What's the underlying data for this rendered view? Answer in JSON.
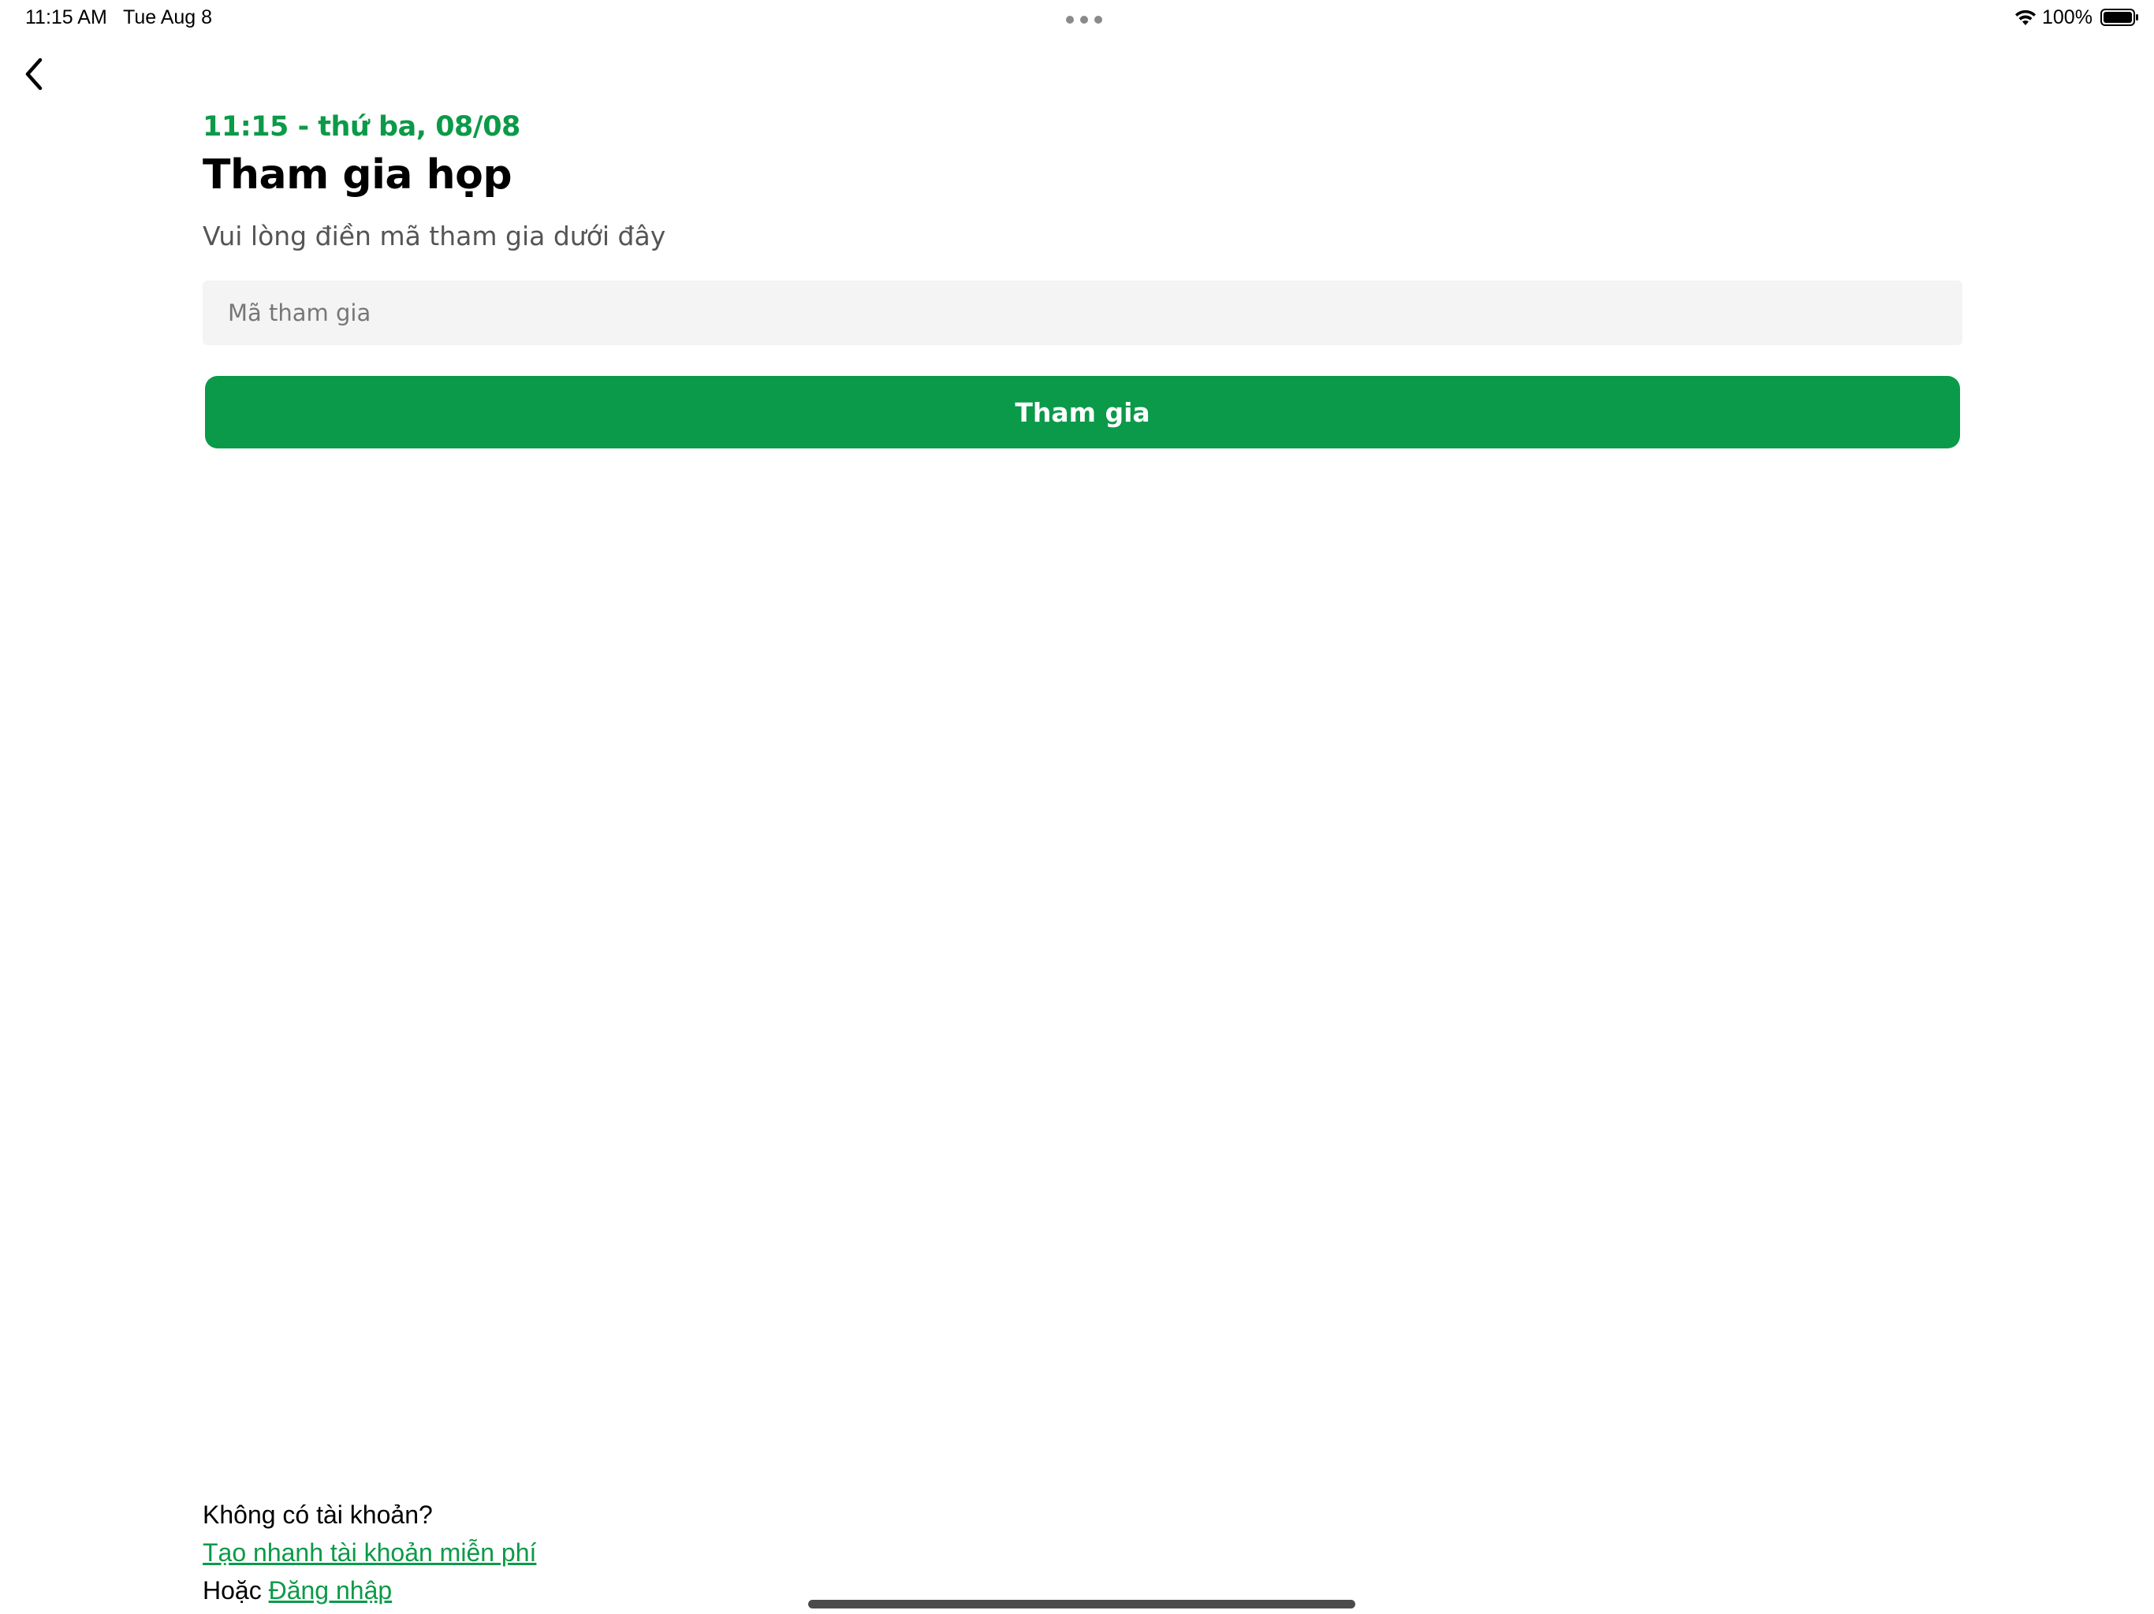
{
  "status_bar": {
    "time": "11:15 AM",
    "date": "Tue Aug 8",
    "battery_percent": "100%",
    "icons": [
      "more-dots-icon",
      "wifi-icon",
      "battery-icon"
    ]
  },
  "nav": {
    "back_icon": "chevron-left-icon"
  },
  "header": {
    "datetime": "11:15 - thứ ba, 08/08",
    "title": "Tham gia họp",
    "subtitle": "Vui lòng điền mã tham gia dưới đây"
  },
  "form": {
    "code_value": "",
    "code_placeholder": "Mã tham gia",
    "join_label": "Tham gia"
  },
  "footer": {
    "no_account": "Không có tài khoản?",
    "create_account_link": "Tạo nhanh tài khoản miễn phí",
    "or_text": "Hoặc",
    "login_link": "Đăng nhập"
  },
  "colors": {
    "accent": "#0a9a49",
    "input_bg": "#f4f4f4",
    "subtitle": "#555555"
  }
}
